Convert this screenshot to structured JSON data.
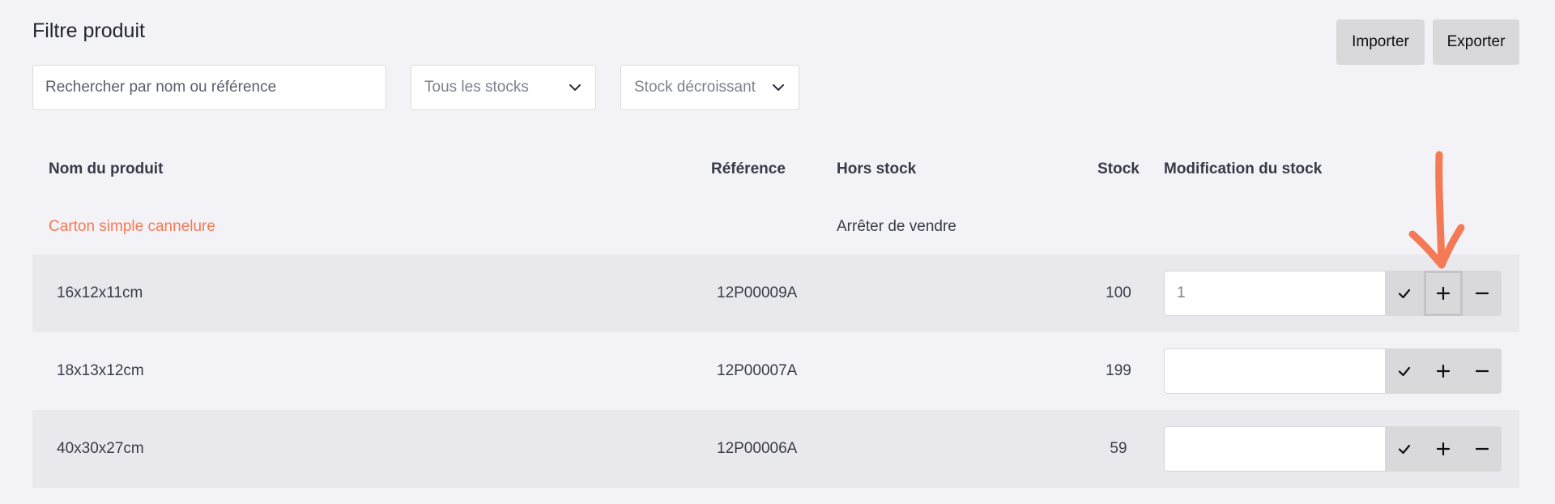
{
  "page": {
    "title": "Filtre produit"
  },
  "actions": {
    "import_label": "Importer",
    "export_label": "Exporter"
  },
  "filters": {
    "search_placeholder": "Rechercher par nom ou référence",
    "stock_filter": "Tous les stocks",
    "sort": "Stock décroissant"
  },
  "table": {
    "headers": {
      "name": "Nom du produit",
      "reference": "Référence",
      "out_of_stock": "Hors stock",
      "stock": "Stock",
      "modification": "Modification du stock"
    },
    "group": {
      "name": "Carton simple cannelure",
      "out_of_stock": "Arrêter de vendre"
    },
    "rows": [
      {
        "name": "16x12x11cm",
        "reference": "12P00009A",
        "stock": "100",
        "qty": "1"
      },
      {
        "name": "18x13x12cm",
        "reference": "12P00007A",
        "stock": "199",
        "qty": ""
      },
      {
        "name": "40x30x27cm",
        "reference": "12P00006A",
        "stock": "59",
        "qty": ""
      }
    ]
  },
  "colors": {
    "accent": "#f47a55",
    "background": "#f3f2f7",
    "row_alt": "#e9e8ed",
    "button": "#d9d9dc"
  },
  "icons": {
    "confirm": "check-icon",
    "increment": "plus-icon",
    "decrement": "minus-icon",
    "dropdown": "chevron-down-icon",
    "annotation": "arrow-down-annotation"
  }
}
